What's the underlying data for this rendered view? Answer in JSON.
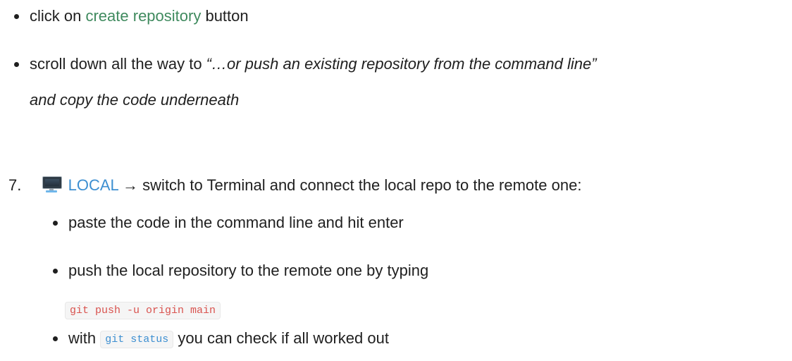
{
  "steps": {
    "bullet1": {
      "prefix": "click on ",
      "link": "create repository",
      "suffix": " button"
    },
    "bullet2": {
      "prefix": "scroll down all the way to ",
      "quote_line1": "“…or push an existing repository from the command line”",
      "quote_line2": "and copy the code underneath"
    },
    "step7": {
      "number": "7.",
      "icon": "desktop-computer-icon",
      "link": "LOCAL",
      "text": " → switch to Terminal and connect the local repo to the remote one:",
      "sub1": "paste the code in the command line and hit enter",
      "sub2": "push the local repository to the remote one by typing",
      "code1": "git push -u origin main",
      "sub3_prefix": "with ",
      "code2": "git status",
      "sub3_suffix": " you can check if all worked out"
    }
  },
  "colors": {
    "green_link": "#3f8a5e",
    "blue_link": "#3d8fd1",
    "code_red": "#d9534f"
  }
}
